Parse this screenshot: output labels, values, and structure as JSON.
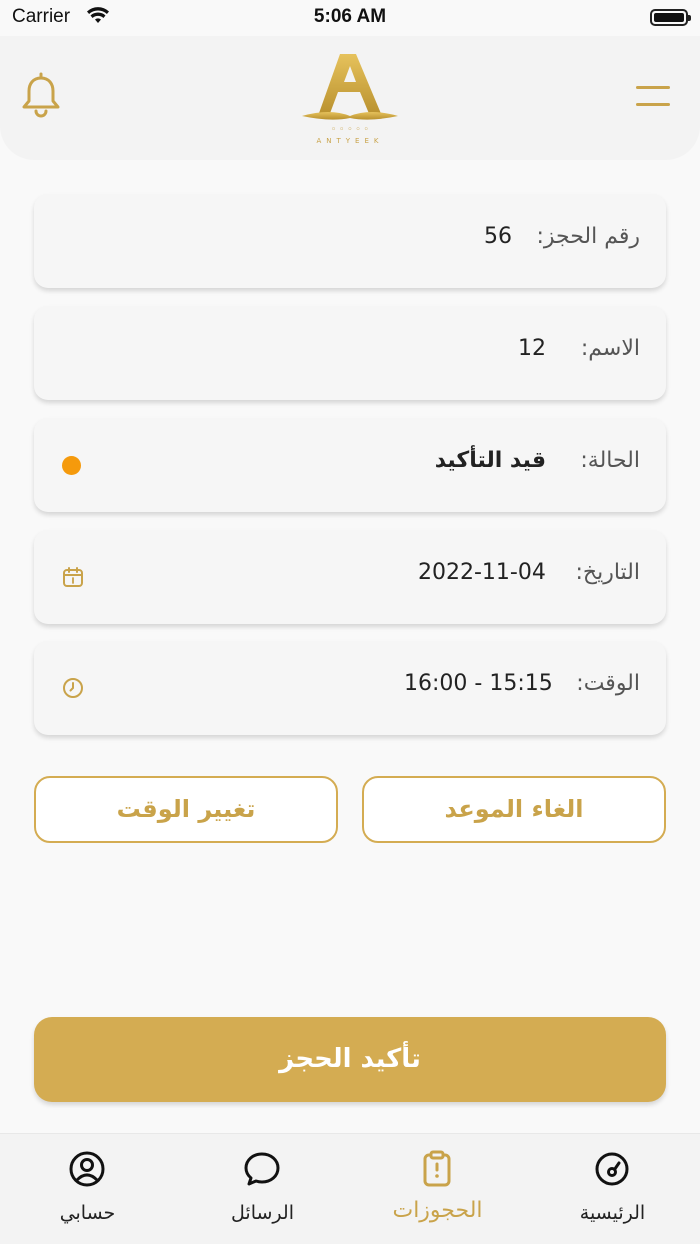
{
  "status_bar": {
    "carrier": "Carrier",
    "time": "5:06 AM"
  },
  "header": {
    "logo_text": "A",
    "logo_caption": "ANTYEEK"
  },
  "booking": {
    "number_label": "رقم الحجز:",
    "number_value": "56",
    "name_label": "الاسم:",
    "name_value": "12",
    "status_label": "الحالة:",
    "status_value": "قيد التأكيد",
    "status_color": "#f59a0c",
    "date_label": "التاريخ:",
    "date_value": "2022-11-04",
    "time_label": "الوقت:",
    "time_value": "15:15 - 16:00"
  },
  "actions": {
    "change_time": "تغيير الوقت",
    "cancel": "الغاء الموعد",
    "confirm": "تأكيد الحجز"
  },
  "tabbar": {
    "items": [
      {
        "label": "حسابي",
        "icon": "profile-icon",
        "active": false
      },
      {
        "label": "الرسائل",
        "icon": "chat-icon",
        "active": false
      },
      {
        "label": "الحجوزات",
        "icon": "clipboard-icon",
        "active": true
      },
      {
        "label": "الرئيسية",
        "icon": "dashboard-icon",
        "active": false
      }
    ]
  },
  "colors": {
    "accent": "#d4ac52",
    "background": "#f9f9f9",
    "card": "#f6f6f6"
  }
}
